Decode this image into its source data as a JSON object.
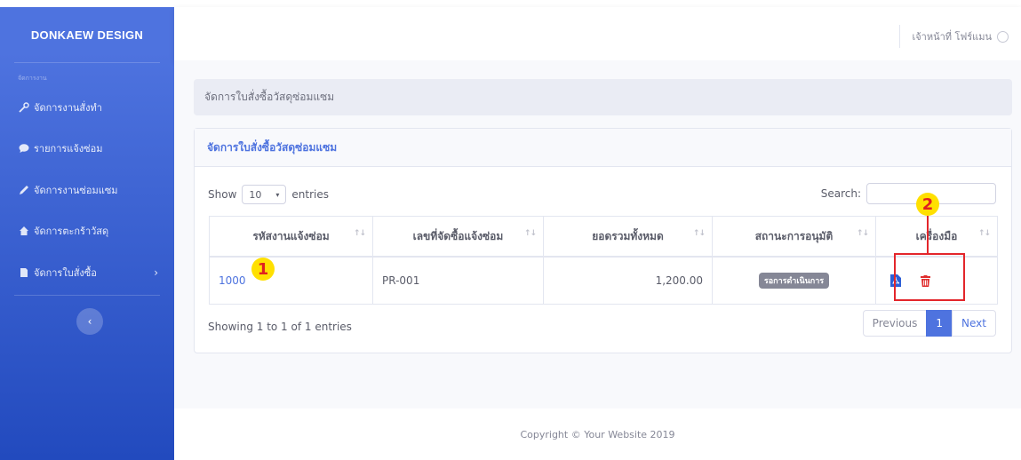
{
  "sidebar": {
    "brand": "DONKAEW DESIGN",
    "heading": "จัดการงาน",
    "items": [
      {
        "label": "จัดการงานสั่งทำ",
        "icon": "wrench-icon"
      },
      {
        "label": "รายการแจ้งซ่อม",
        "icon": "comment-icon"
      },
      {
        "label": "จัดการงานซ่อมแซม",
        "icon": "pencil-icon"
      },
      {
        "label": "จัดการตะกร้าวัสดุ",
        "icon": "home-icon"
      },
      {
        "label": "จัดการใบสั่งซื้อ",
        "icon": "file-icon"
      }
    ],
    "toggle_icon": "chevron-left-icon"
  },
  "topbar": {
    "user_name": "เจ้าหน้าที่ โฟร์แมน",
    "avatar_icon": "user-circle-icon"
  },
  "breadcrumb": "จัดการใบสั่งซื้อวัสดุซ่อมแซม",
  "card": {
    "title": "จัดการใบสั่งซื้อวัสดุซ่อมแซม",
    "show_label": "Show",
    "entries_value": "10",
    "entries_label": "entries",
    "search_label": "Search:",
    "search_value": "",
    "columns": [
      "รหัสงานแจ้งซ่อม",
      "เลขที่จัดซื้อแจ้งซ่อม",
      "ยอดรวมทั้งหมด",
      "สถานะการอนุมัติ",
      "เครื่องมือ"
    ],
    "rows": [
      {
        "code": "1000",
        "pr_no": "PR-001",
        "total": "1,200.00",
        "status": "รอการดำเนินการ"
      }
    ],
    "info": "Showing 1 to 1 of 1 entries",
    "pagination": {
      "previous": "Previous",
      "page": "1",
      "next": "Next"
    }
  },
  "annotations": {
    "marker1": "1",
    "marker2": "2"
  },
  "footer": "Copyright © Your Website 2019",
  "colors": {
    "primary": "#4e73df",
    "pdf_icon": "#2d5fd6",
    "delete_icon": "#e02d2d",
    "highlight": "#e3262b",
    "marker": "#ffe000"
  }
}
